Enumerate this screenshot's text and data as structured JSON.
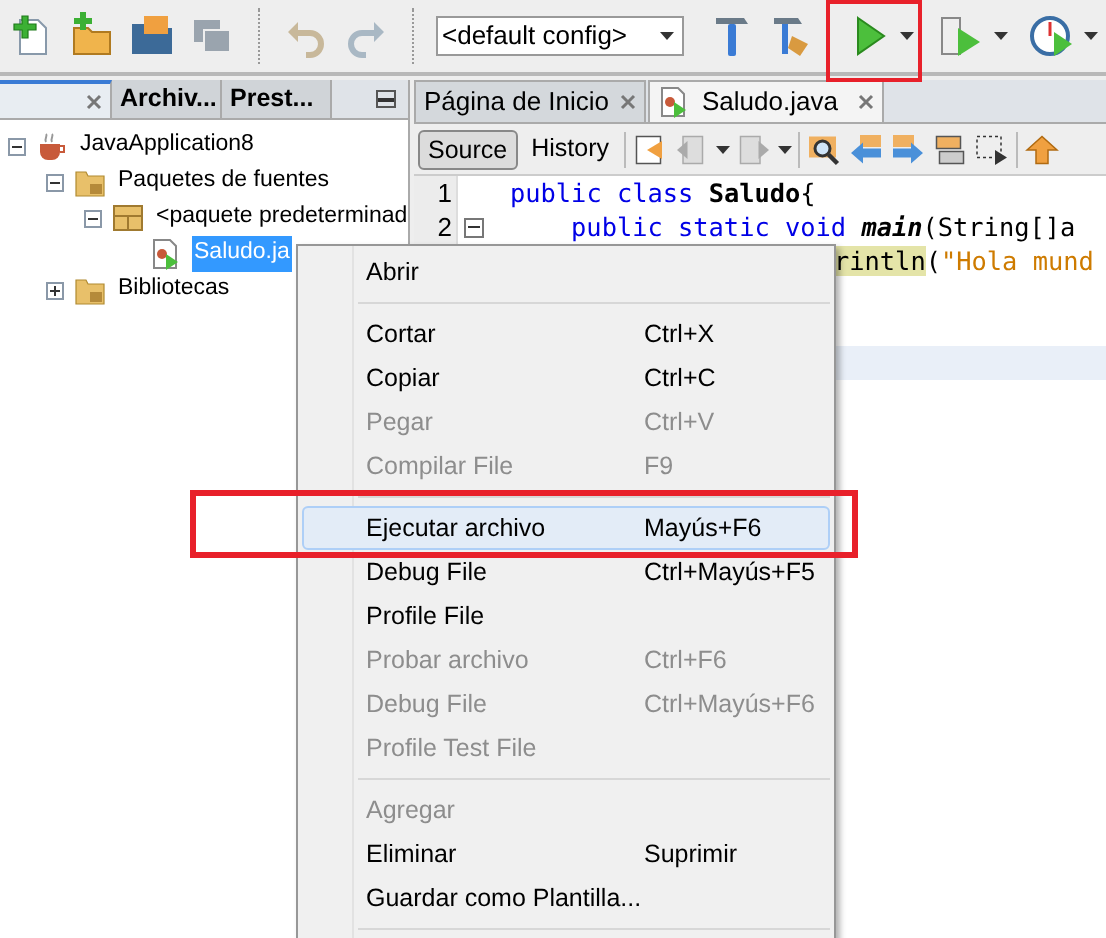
{
  "toolbar": {
    "config": "<default config>"
  },
  "left_panel": {
    "tabs": [
      {
        "selected": true
      },
      {
        "label": "Archiv...",
        "selected": false
      },
      {
        "label": "Prest...",
        "selected": false
      }
    ],
    "tree": [
      {
        "label": "JavaApplication8",
        "kind": "project",
        "expanded": true,
        "children": [
          {
            "label": "Paquetes de fuentes",
            "kind": "folder",
            "expanded": true,
            "children": [
              {
                "label": "<paquete predeterminad",
                "kind": "package",
                "expanded": true,
                "children": [
                  {
                    "label": "Saludo.ja",
                    "kind": "file",
                    "selected": true
                  }
                ]
              }
            ]
          },
          {
            "label": "Bibliotecas",
            "kind": "folder",
            "expanded": false
          }
        ]
      }
    ]
  },
  "editor": {
    "tabs": [
      {
        "label": "Página de Inicio",
        "selected": false
      },
      {
        "label": "Saludo.java",
        "selected": true
      }
    ],
    "views": [
      {
        "label": "Source",
        "selected": true
      },
      {
        "label": "History",
        "selected": false
      }
    ],
    "lines": [
      {
        "number": "1",
        "current": false,
        "segments": [
          {
            "kind": "keyword",
            "text": "public class "
          },
          {
            "kind": "name",
            "text": "Saludo"
          },
          {
            "kind": "plain",
            "text": "{"
          }
        ]
      },
      {
        "number": "2",
        "current": false,
        "nested": true,
        "segments": [
          {
            "kind": "keyword",
            "text": "public static void "
          },
          {
            "kind": "method",
            "text": "main"
          },
          {
            "kind": "plain",
            "text": "(String[]a"
          }
        ]
      },
      {
        "current": false,
        "segments": [
          {
            "kind": "marked",
            "text": "rintln"
          },
          {
            "kind": "plain",
            "text": "("
          },
          {
            "kind": "string",
            "text": "\"Hola mund"
          }
        ]
      },
      {
        "current": false
      },
      {
        "current": false
      },
      {
        "current": true
      }
    ]
  },
  "context_menu": {
    "items": [
      {
        "kind": "item",
        "label": "Abrir",
        "disabled": false,
        "selected": false
      },
      {
        "kind": "separator"
      },
      {
        "kind": "item",
        "label": "Cortar",
        "shortcut": "Ctrl+X",
        "disabled": false,
        "selected": false
      },
      {
        "kind": "item",
        "label": "Copiar",
        "shortcut": "Ctrl+C",
        "disabled": false,
        "selected": false
      },
      {
        "kind": "item",
        "label": "Pegar",
        "shortcut": "Ctrl+V",
        "disabled": true,
        "selected": false
      },
      {
        "kind": "item",
        "label": "Compilar File",
        "shortcut": "F9",
        "disabled": true,
        "selected": false
      },
      {
        "kind": "separator"
      },
      {
        "kind": "item",
        "label": "Ejecutar archivo",
        "shortcut": "Mayús+F6",
        "disabled": false,
        "selected": true
      },
      {
        "kind": "item",
        "label": "Debug File",
        "shortcut": "Ctrl+Mayús+F5",
        "disabled": false,
        "selected": false
      },
      {
        "kind": "item",
        "label": "Profile File",
        "disabled": false,
        "selected": false
      },
      {
        "kind": "item",
        "label": "Probar archivo",
        "shortcut": "Ctrl+F6",
        "disabled": true,
        "selected": false
      },
      {
        "kind": "item",
        "label": "Debug File",
        "shortcut": "Ctrl+Mayús+F6",
        "disabled": true,
        "selected": false
      },
      {
        "kind": "item",
        "label": "Profile Test File",
        "disabled": true,
        "selected": false
      },
      {
        "kind": "separator"
      },
      {
        "kind": "item",
        "label": "Agregar",
        "disabled": true,
        "selected": false
      },
      {
        "kind": "item",
        "label": "Eliminar",
        "shortcut": "Suprimir",
        "disabled": false,
        "selected": false
      },
      {
        "kind": "item",
        "label": "Guardar como Plantilla...",
        "disabled": false,
        "selected": false
      },
      {
        "kind": "separator"
      }
    ]
  }
}
